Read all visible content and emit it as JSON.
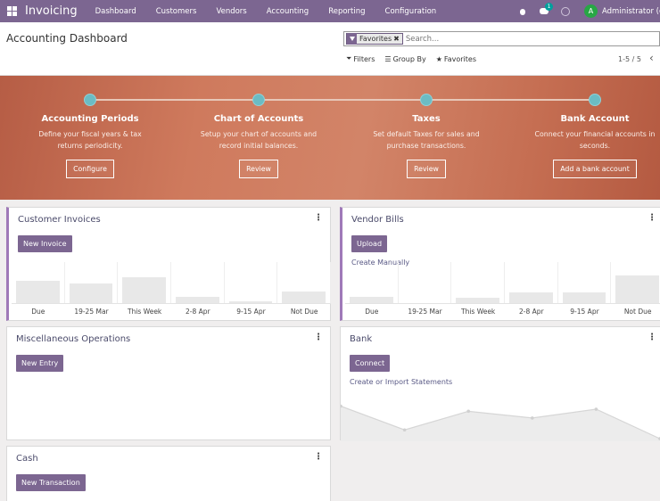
{
  "navbar": {
    "app_name": "Invoicing",
    "menu": [
      "Dashboard",
      "Customers",
      "Vendors",
      "Accounting",
      "Reporting",
      "Configuration"
    ],
    "chat_count": "1",
    "avatar_letter": "A",
    "user": "Administrator (co"
  },
  "control": {
    "title": "Accounting Dashboard",
    "facet": "Favorites",
    "facet_close": "✖",
    "search_placeholder": "Search...",
    "filters": "Filters",
    "group_by": "Group By",
    "favorites": "Favorites",
    "pager": "1-5 / 5",
    "prev": "‹"
  },
  "banner": {
    "steps": [
      {
        "title": "Accounting Periods",
        "desc": "Define your fiscal years & tax returns periodicity.",
        "button": "Configure"
      },
      {
        "title": "Chart of Accounts",
        "desc": "Setup your chart of accounts and record initial balances.",
        "button": "Review"
      },
      {
        "title": "Taxes",
        "desc": "Set default Taxes for sales and purchase transactions.",
        "button": "Review"
      },
      {
        "title": "Bank Account",
        "desc": "Connect your financial accounts in seconds.",
        "button": "Add a bank account"
      }
    ]
  },
  "cards": {
    "customer_invoices": {
      "title": "Customer Invoices",
      "button": "New Invoice",
      "kebab": "⋮"
    },
    "vendor_bills": {
      "title": "Vendor Bills",
      "button": "Upload",
      "link": "Create Manually",
      "kebab": "⋮"
    },
    "misc": {
      "title": "Miscellaneous Operations",
      "button": "New Entry",
      "kebab": "⋮"
    },
    "bank": {
      "title": "Bank",
      "button": "Connect",
      "link": "Create or Import Statements",
      "kebab": "⋮"
    },
    "cash": {
      "title": "Cash",
      "button": "New Transaction",
      "kebab": "⋮"
    }
  },
  "chart_data": [
    {
      "type": "bar",
      "categories": [
        "Due",
        "19-25 Mar",
        "This Week",
        "2-8 Apr",
        "9-15 Apr",
        "Not Due"
      ],
      "values": [
        0.55,
        0.48,
        0.62,
        0.15,
        0.05,
        0.28
      ]
    },
    {
      "type": "bar",
      "categories": [
        "Due",
        "19-25 Mar",
        "This Week",
        "2-8 Apr",
        "9-15 Apr",
        "Not Due"
      ],
      "values": [
        0.15,
        0.0,
        0.13,
        0.27,
        0.27,
        0.68
      ]
    },
    {
      "type": "area",
      "values": [
        0.68,
        0.22,
        0.58,
        0.45,
        0.62,
        0.05
      ]
    }
  ],
  "colors": {
    "brand": "#7c6691",
    "accent": "#9f79b8",
    "bar": "#e8e8e8"
  }
}
